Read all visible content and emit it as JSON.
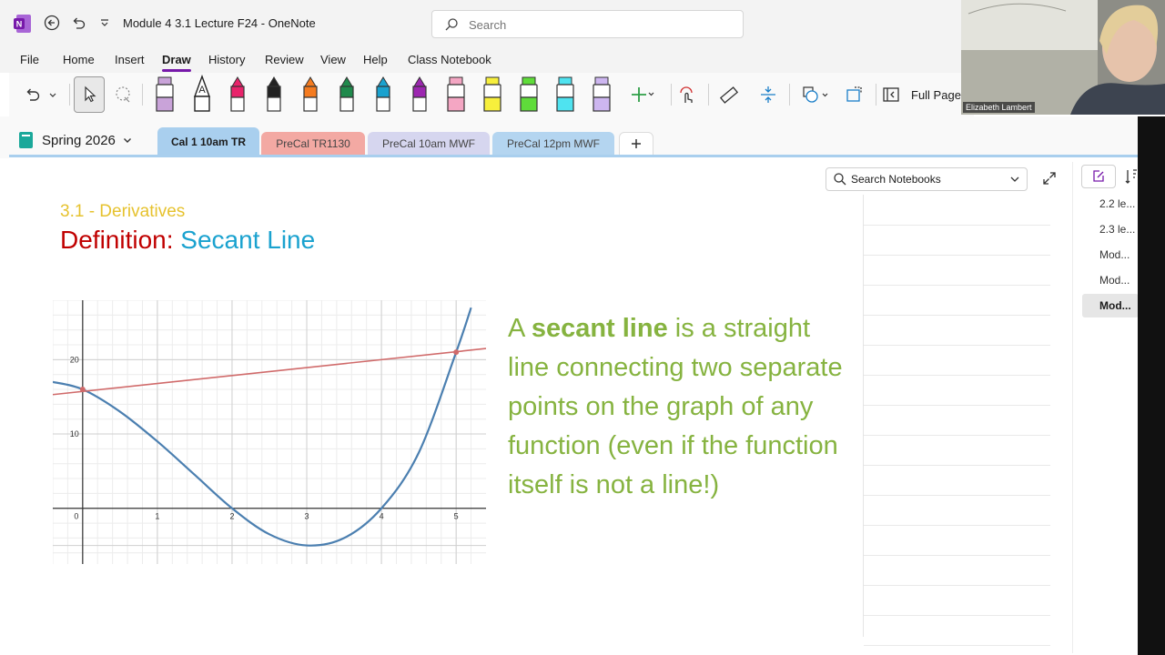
{
  "app": {
    "doc_title": "Module 4 3.1 Lecture F24  -  OneNote",
    "search_placeholder": "Search"
  },
  "menu": {
    "tabs": [
      "File",
      "Home",
      "Insert",
      "Draw",
      "History",
      "Review",
      "View",
      "Help",
      "Class Notebook"
    ],
    "active": "Draw"
  },
  "ribbon": {
    "full_page_label": "Full Page",
    "pen_colors": [
      "#c9a3d9",
      "#ffffff",
      "#e8246b",
      "#222222",
      "#f47b20",
      "#1f8a4c",
      "#1aa2cf",
      "#9c27b0",
      "#f4a6c3",
      "#f7ef3c",
      "#5fdc3a",
      "#4fe3f0",
      "#cdb6f0"
    ]
  },
  "notebook": {
    "name": "Spring 2026",
    "sections": [
      {
        "label": "Cal 1 10am TR",
        "color": "#a9cfee",
        "active": true
      },
      {
        "label": "PreCal TR1130",
        "color": "#f3a9a3",
        "active": false
      },
      {
        "label": "PreCal 10am MWF",
        "color": "#d6d6ef",
        "active": false
      },
      {
        "label": "PreCal 12pm MWF",
        "color": "#b4d5f0",
        "active": false
      }
    ]
  },
  "note": {
    "heading_small": "3.1 - Derivatives",
    "heading_def": "Definition:",
    "heading_term": "Secant Line",
    "body_prefix": "A ",
    "body_bold": "secant line",
    "body_rest": " is a straight line connecting two separate points on the graph of any function (even if the function itself is not a line!)"
  },
  "chart_data": {
    "type": "line",
    "xlim": [
      -0.4,
      5.4
    ],
    "ylim": [
      -7.5,
      28
    ],
    "x_ticks": [
      0,
      1,
      2,
      3,
      4,
      5
    ],
    "y_ticks": [
      10,
      20
    ],
    "grid": true,
    "series": [
      {
        "kind": "function",
        "color": "#4b7fb0",
        "points": [
          [
            -0.4,
            17
          ],
          [
            0,
            16
          ],
          [
            0.5,
            13
          ],
          [
            1,
            9
          ],
          [
            1.5,
            4.5
          ],
          [
            2,
            0
          ],
          [
            2.5,
            -3.5
          ],
          [
            3,
            -5
          ],
          [
            3.5,
            -4
          ],
          [
            4,
            0
          ],
          [
            4.5,
            7.5
          ],
          [
            5,
            21
          ],
          [
            5.2,
            27
          ]
        ]
      },
      {
        "kind": "secant",
        "color": "#d06a6a",
        "points": [
          [
            -0.4,
            15.3
          ],
          [
            5.4,
            21.5
          ]
        ]
      }
    ],
    "marked_points": [
      [
        0,
        16
      ],
      [
        5,
        21
      ]
    ]
  },
  "right_pane": {
    "search_label": "Search Notebooks",
    "pages": [
      "2.2 le...",
      "2.3 le...",
      "Mod...",
      "Mod...",
      "Mod..."
    ],
    "active_page": 4
  },
  "webcam": {
    "name": "Elizabeth Lambert"
  }
}
